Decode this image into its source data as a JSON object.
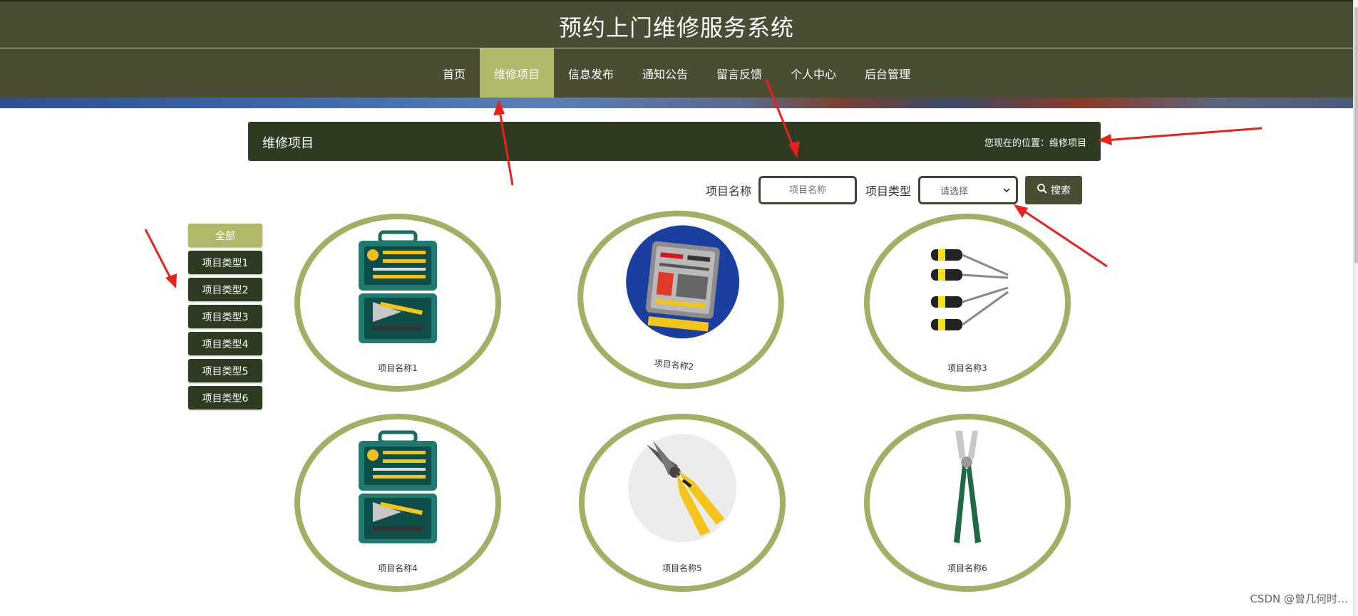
{
  "site": {
    "title": "预约上门维修服务系统"
  },
  "nav": {
    "items": [
      {
        "label": "首页",
        "active": false
      },
      {
        "label": "维修项目",
        "active": true
      },
      {
        "label": "信息发布",
        "active": false
      },
      {
        "label": "通知公告",
        "active": false
      },
      {
        "label": "留言反馈",
        "active": false
      },
      {
        "label": "个人中心",
        "active": false
      },
      {
        "label": "后台管理",
        "active": false
      }
    ]
  },
  "page": {
    "title": "维修项目",
    "breadcrumb": "您现在的位置：维修项目"
  },
  "search": {
    "name_label": "项目名称",
    "name_placeholder": "项目名称",
    "type_label": "项目类型",
    "type_selected": "请选择",
    "button_label": "搜索"
  },
  "categories": [
    {
      "label": "全部",
      "active": true
    },
    {
      "label": "项目类型1",
      "active": false
    },
    {
      "label": "项目类型2",
      "active": false
    },
    {
      "label": "项目类型3",
      "active": false
    },
    {
      "label": "项目类型4",
      "active": false
    },
    {
      "label": "项目类型5",
      "active": false
    },
    {
      "label": "项目类型6",
      "active": false
    }
  ],
  "products": [
    {
      "name": "项目名称1",
      "image": "toolbox-icon"
    },
    {
      "name": "项目名称2",
      "image": "tool-kit-case-icon"
    },
    {
      "name": "项目名称3",
      "image": "screwdrivers-icon"
    },
    {
      "name": "项目名称4",
      "image": "toolbox-icon"
    },
    {
      "name": "项目名称5",
      "image": "pliers-icon"
    },
    {
      "name": "项目名称6",
      "image": "slip-joint-pliers-icon"
    }
  ],
  "watermark": "CSDN @曾几何时…",
  "colors": {
    "header_bg": "#4b4c34",
    "nav_active": "#b1b869",
    "ring": "#a3af64",
    "title_bar": "#2f3a22",
    "annotation_arrow": "#e8211a"
  }
}
